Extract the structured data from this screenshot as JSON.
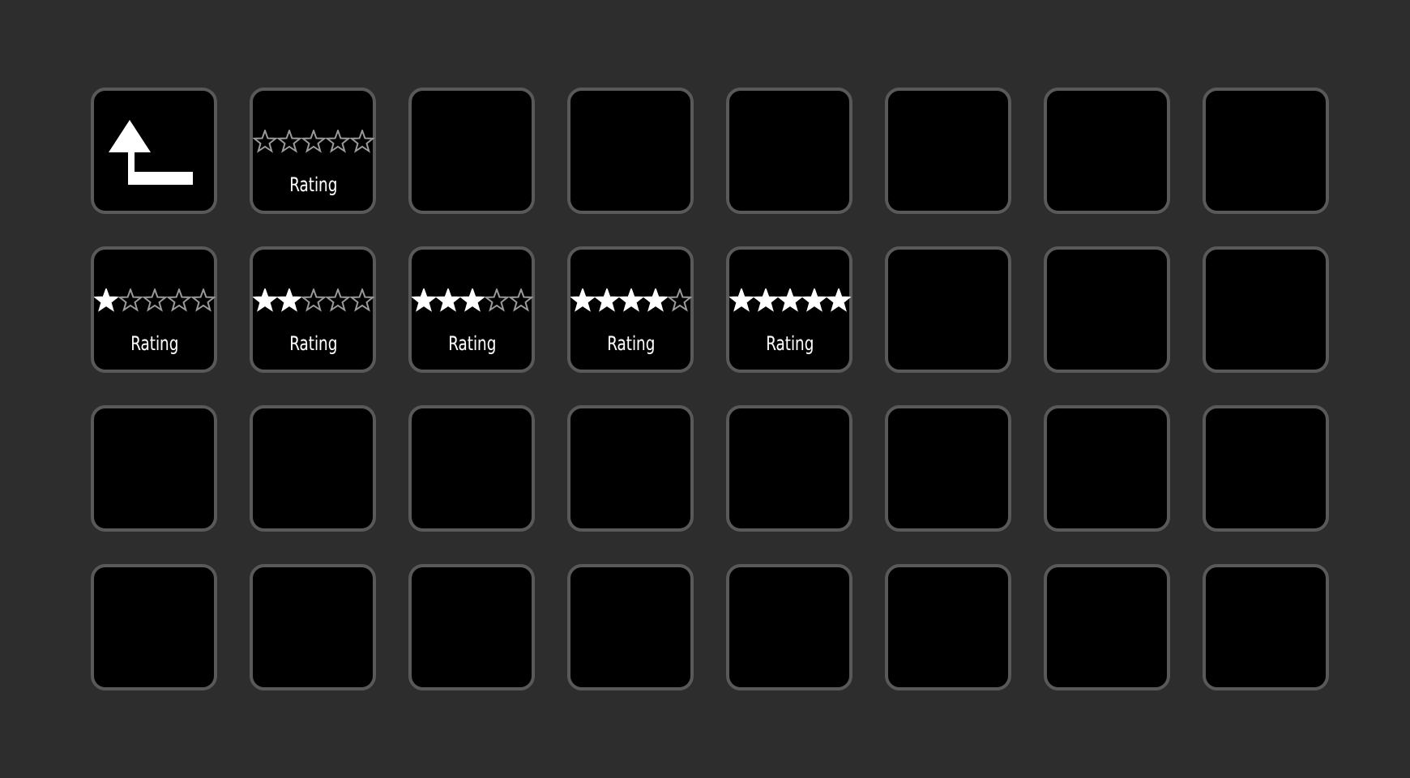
{
  "keys": [
    {
      "kind": "back"
    },
    {
      "kind": "rating",
      "stars": 0,
      "label": "Rating"
    },
    {
      "kind": "empty"
    },
    {
      "kind": "empty"
    },
    {
      "kind": "empty"
    },
    {
      "kind": "empty"
    },
    {
      "kind": "empty"
    },
    {
      "kind": "empty"
    },
    {
      "kind": "rating",
      "stars": 1,
      "label": "Rating"
    },
    {
      "kind": "rating",
      "stars": 2,
      "label": "Rating"
    },
    {
      "kind": "rating",
      "stars": 3,
      "label": "Rating"
    },
    {
      "kind": "rating",
      "stars": 4,
      "label": "Rating"
    },
    {
      "kind": "rating",
      "stars": 5,
      "label": "Rating"
    },
    {
      "kind": "empty"
    },
    {
      "kind": "empty"
    },
    {
      "kind": "empty"
    },
    {
      "kind": "empty"
    },
    {
      "kind": "empty"
    },
    {
      "kind": "empty"
    },
    {
      "kind": "empty"
    },
    {
      "kind": "empty"
    },
    {
      "kind": "empty"
    },
    {
      "kind": "empty"
    },
    {
      "kind": "empty"
    },
    {
      "kind": "empty"
    },
    {
      "kind": "empty"
    },
    {
      "kind": "empty"
    },
    {
      "kind": "empty"
    },
    {
      "kind": "empty"
    },
    {
      "kind": "empty"
    },
    {
      "kind": "empty"
    },
    {
      "kind": "empty"
    }
  ]
}
